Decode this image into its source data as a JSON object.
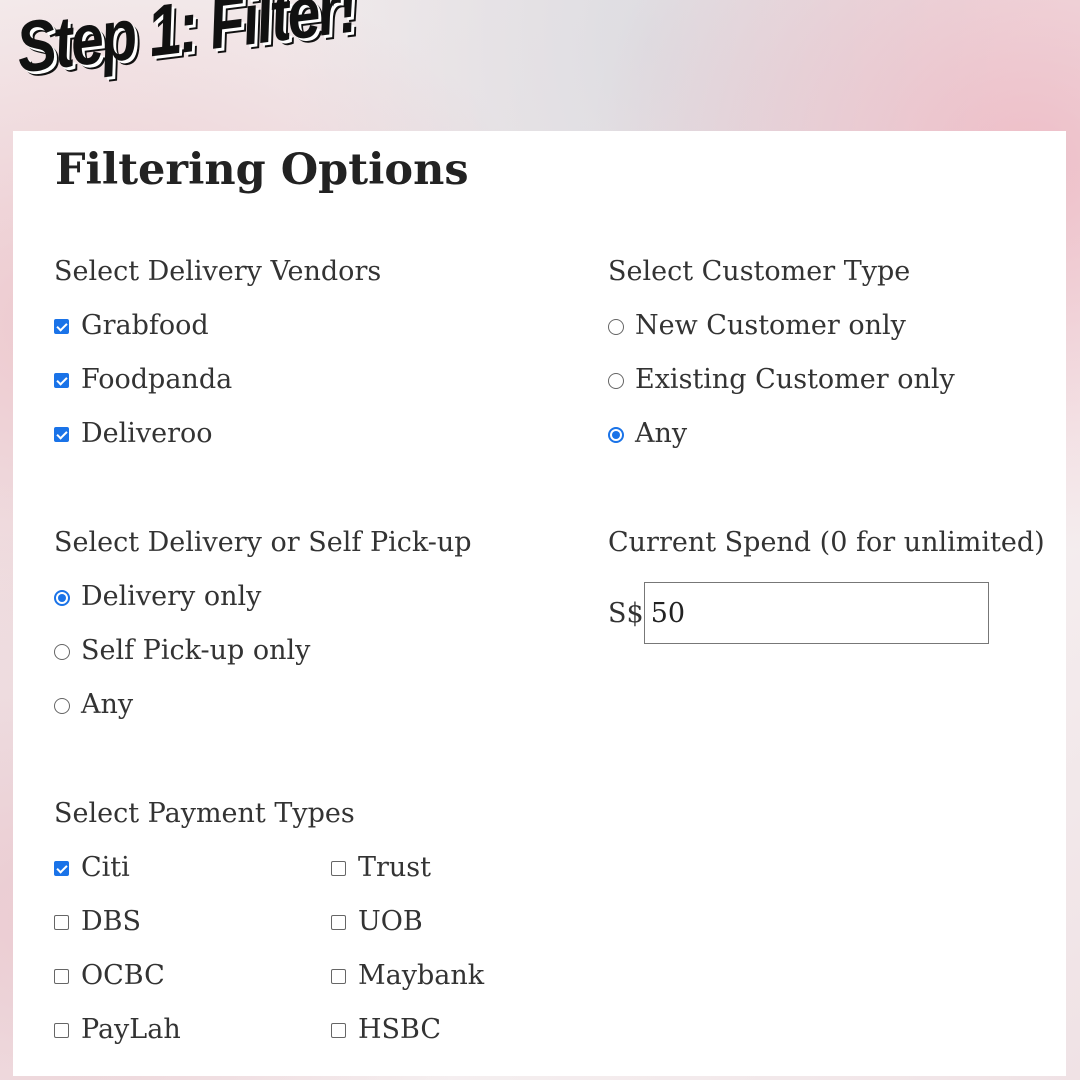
{
  "banner": "Step 1: Filter!",
  "title": "Filtering Options",
  "vendors": {
    "label": "Select Delivery Vendors",
    "options": [
      {
        "label": "Grabfood",
        "checked": true
      },
      {
        "label": "Foodpanda",
        "checked": true
      },
      {
        "label": "Deliveroo",
        "checked": true
      }
    ]
  },
  "customer_type": {
    "label": "Select Customer Type",
    "options": [
      {
        "label": "New Customer only",
        "selected": false
      },
      {
        "label": "Existing Customer only",
        "selected": false
      },
      {
        "label": "Any",
        "selected": true
      }
    ]
  },
  "delivery_mode": {
    "label": "Select Delivery or Self Pick-up",
    "options": [
      {
        "label": "Delivery only",
        "selected": true
      },
      {
        "label": "Self Pick-up only",
        "selected": false
      },
      {
        "label": "Any",
        "selected": false
      }
    ]
  },
  "spend": {
    "label": "Current Spend (0 for unlimited)",
    "currency": "S$",
    "value": "50"
  },
  "payment": {
    "label": "Select Payment Types",
    "options": [
      {
        "label": "Citi",
        "checked": true
      },
      {
        "label": "Trust",
        "checked": false
      },
      {
        "label": "DBS",
        "checked": false
      },
      {
        "label": "UOB",
        "checked": false
      },
      {
        "label": "OCBC",
        "checked": false
      },
      {
        "label": "Maybank",
        "checked": false
      },
      {
        "label": "PayLah",
        "checked": false
      },
      {
        "label": "HSBC",
        "checked": false
      }
    ]
  },
  "colors": {
    "accent": "#1a73e8",
    "text": "#333333",
    "panel": "#ffffff"
  }
}
